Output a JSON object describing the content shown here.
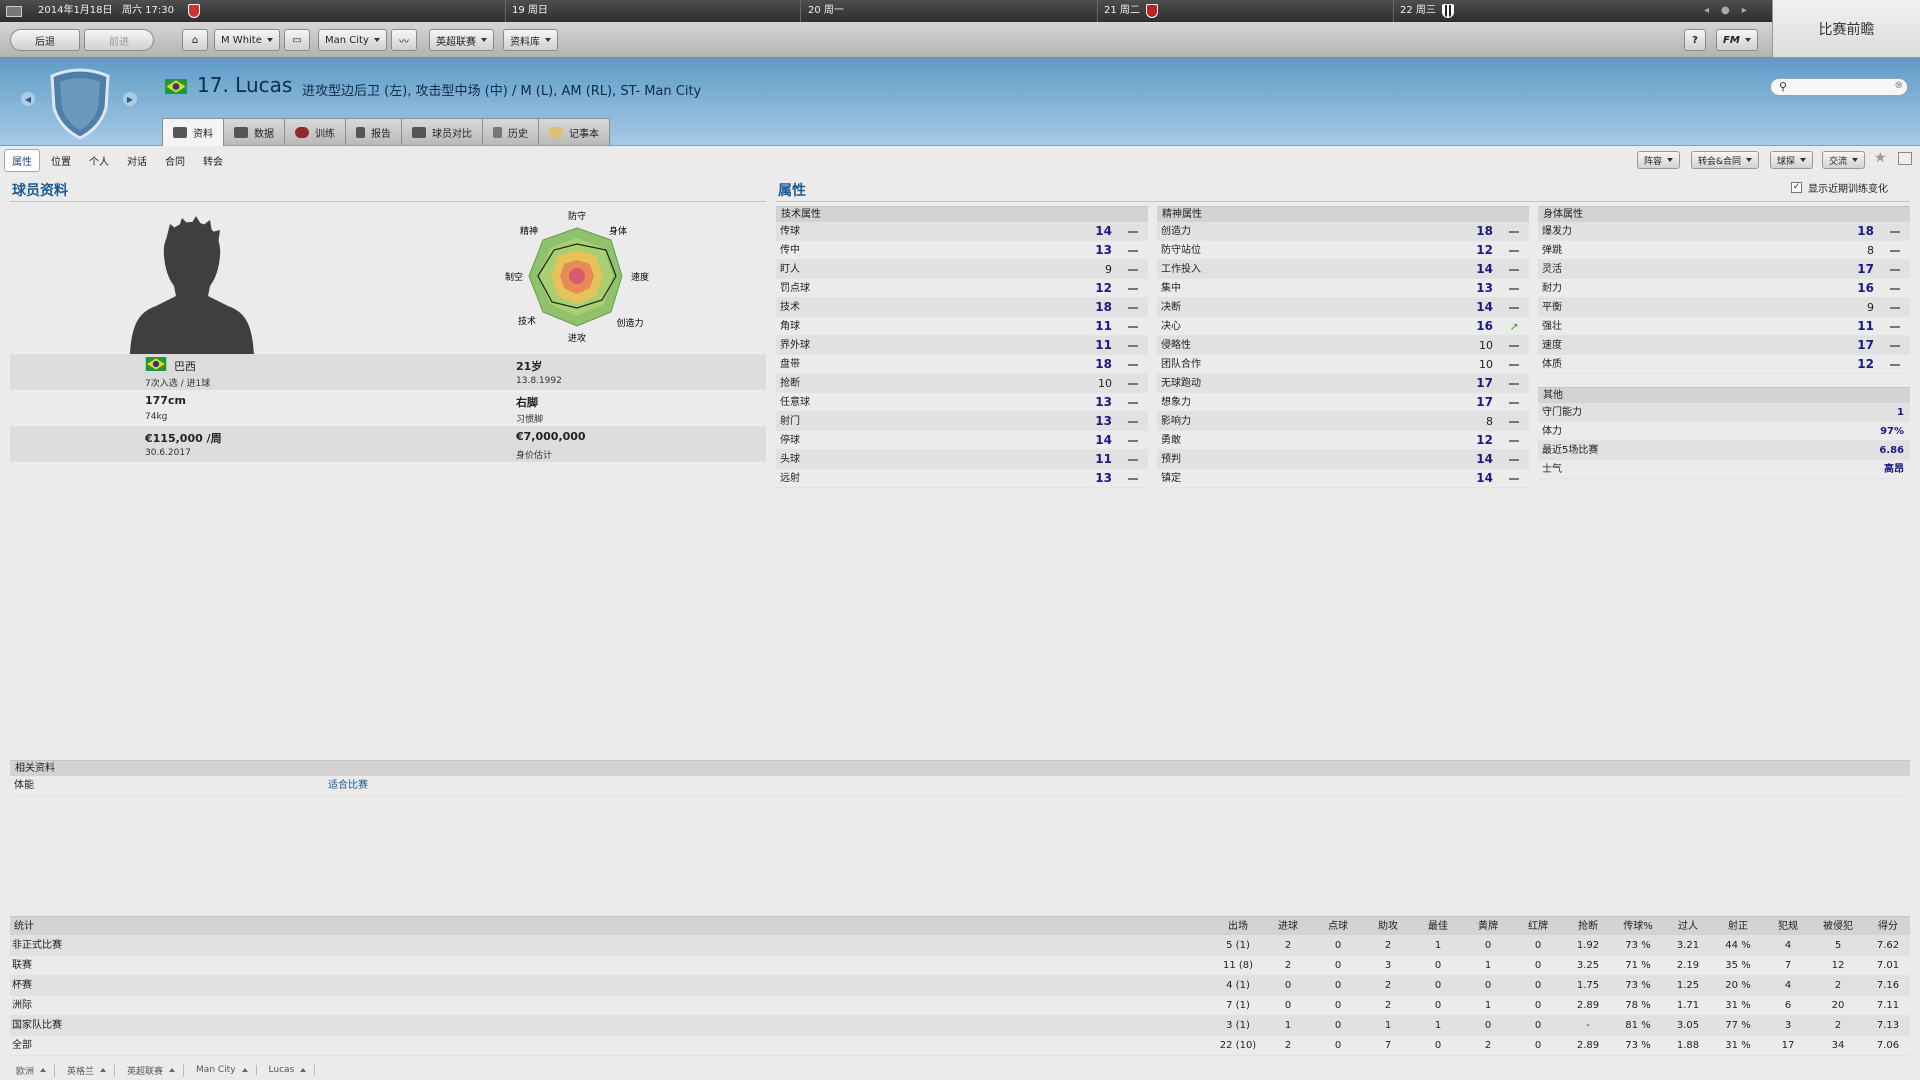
{
  "topbar": {
    "date": "2014年1月18日",
    "day_time": "周六 17:30",
    "day19": "19 周日",
    "day20": "20 周一",
    "day21": "21 周二",
    "day22": "22 周三"
  },
  "toolbar": {
    "back": "后退",
    "forward": "前进",
    "manager": "M White",
    "club": "Man City",
    "league": "英超联赛",
    "database": "资料库",
    "help": "?",
    "fm": "FM"
  },
  "preview": {
    "label": "比赛前瞻"
  },
  "player": {
    "title": "17. Lucas",
    "positions": "进攻型边后卫 (左), 攻击型中场 (中) / M (L), AM (RL), ST- Man City"
  },
  "tabs": [
    "资料",
    "数据",
    "训练",
    "报告",
    "球员对比",
    "历史",
    "记事本"
  ],
  "subnav": [
    "属性",
    "位置",
    "个人",
    "对话",
    "合同",
    "转会"
  ],
  "actions": {
    "lineup": "阵容",
    "transfer": "转会&合同",
    "scout": "球探",
    "interact": "交流",
    "show_training": "显示近期训练变化"
  },
  "profile": {
    "section_title": "球员资料",
    "nation": "巴西",
    "caps": "7次入选 / 进1球",
    "age": "21岁",
    "dob": "13.8.1992",
    "height": "177cm",
    "weight": "74kg",
    "foot": "右脚",
    "foot_label": "习惯脚",
    "wage": "€115,000 /周",
    "contract_end": "30.6.2017",
    "value": "€7,000,000",
    "value_label": "身价估计"
  },
  "radar": {
    "labels": [
      "防守",
      "身体",
      "速度",
      "创造力",
      "进攻",
      "技术",
      "制空",
      "精神"
    ]
  },
  "attributes": {
    "section_title": "属性",
    "technical": {
      "title": "技术属性",
      "items": [
        {
          "name": "传球",
          "value": 14
        },
        {
          "name": "传中",
          "value": 13
        },
        {
          "name": "盯人",
          "value": 9
        },
        {
          "name": "罚点球",
          "value": 12
        },
        {
          "name": "技术",
          "value": 18
        },
        {
          "name": "角球",
          "value": 11
        },
        {
          "name": "界外球",
          "value": 11
        },
        {
          "name": "盘带",
          "value": 18
        },
        {
          "name": "抢断",
          "value": 10
        },
        {
          "name": "任意球",
          "value": 13
        },
        {
          "name": "射门",
          "value": 13
        },
        {
          "name": "停球",
          "value": 14
        },
        {
          "name": "头球",
          "value": 11
        },
        {
          "name": "远射",
          "value": 13
        }
      ]
    },
    "mental": {
      "title": "精神属性",
      "items": [
        {
          "name": "创造力",
          "value": 18
        },
        {
          "name": "防守站位",
          "value": 12
        },
        {
          "name": "工作投入",
          "value": 14
        },
        {
          "name": "集中",
          "value": 13
        },
        {
          "name": "决断",
          "value": 14
        },
        {
          "name": "决心",
          "value": 16,
          "trend": "up"
        },
        {
          "name": "侵略性",
          "value": 10
        },
        {
          "name": "团队合作",
          "value": 10
        },
        {
          "name": "无球跑动",
          "value": 17
        },
        {
          "name": "想象力",
          "value": 17
        },
        {
          "name": "影响力",
          "value": 8
        },
        {
          "name": "勇敢",
          "value": 12
        },
        {
          "name": "预判",
          "value": 14
        },
        {
          "name": "镇定",
          "value": 14
        }
      ]
    },
    "physical": {
      "title": "身体属性",
      "items": [
        {
          "name": "爆发力",
          "value": 18
        },
        {
          "name": "弹跳",
          "value": 8
        },
        {
          "name": "灵活",
          "value": 17
        },
        {
          "name": "耐力",
          "value": 16
        },
        {
          "name": "平衡",
          "value": 9
        },
        {
          "name": "强壮",
          "value": 11
        },
        {
          "name": "速度",
          "value": 17
        },
        {
          "name": "体质",
          "value": 12
        }
      ]
    },
    "other": {
      "title": "其他",
      "items": [
        {
          "name": "守门能力",
          "value": "1"
        },
        {
          "name": "体力",
          "value": "97%"
        },
        {
          "name": "最近5场比赛",
          "value": "6.86"
        },
        {
          "name": "士气",
          "value": "高昂"
        }
      ]
    }
  },
  "related": {
    "title": "相关资料",
    "fitness_label": "体能",
    "fitness_value": "适合比赛"
  },
  "stats": {
    "title": "统计",
    "columns": [
      "出场",
      "进球",
      "点球",
      "助攻",
      "最佳",
      "黄牌",
      "红牌",
      "抢断",
      "传球%",
      "过人",
      "射正",
      "犯规",
      "被侵犯",
      "得分"
    ],
    "rows": [
      {
        "label": "非正式比赛",
        "cells": [
          "5 (1)",
          "2",
          "0",
          "2",
          "1",
          "0",
          "0",
          "1.92",
          "73 %",
          "3.21",
          "44 %",
          "4",
          "5",
          "7.62"
        ]
      },
      {
        "label": "联赛",
        "cells": [
          "11 (8)",
          "2",
          "0",
          "3",
          "0",
          "1",
          "0",
          "3.25",
          "71 %",
          "2.19",
          "35 %",
          "7",
          "12",
          "7.01"
        ]
      },
      {
        "label": "杯赛",
        "cells": [
          "4 (1)",
          "0",
          "0",
          "2",
          "0",
          "0",
          "0",
          "1.75",
          "73 %",
          "1.25",
          "20 %",
          "4",
          "2",
          "7.16"
        ]
      },
      {
        "label": "洲际",
        "cells": [
          "7 (1)",
          "0",
          "0",
          "2",
          "0",
          "1",
          "0",
          "2.89",
          "78 %",
          "1.71",
          "31 %",
          "6",
          "20",
          "7.11"
        ]
      },
      {
        "label": "国家队比赛",
        "cells": [
          "3 (1)",
          "1",
          "0",
          "1",
          "1",
          "0",
          "0",
          "-",
          "81 %",
          "3.05",
          "77 %",
          "3",
          "2",
          "7.13"
        ]
      },
      {
        "label": "全部",
        "cells": [
          "22 (10)",
          "2",
          "0",
          "7",
          "0",
          "2",
          "0",
          "2.89",
          "73 %",
          "1.88",
          "31 %",
          "17",
          "34",
          "7.06"
        ]
      }
    ]
  },
  "breadcrumbs": [
    "欧洲",
    "英格兰",
    "英超联赛",
    "Man City",
    "Lucas"
  ],
  "colors": {
    "accent": "#1d5b92",
    "value": "#1a1a82",
    "header_bg": "#7fb2d8"
  }
}
